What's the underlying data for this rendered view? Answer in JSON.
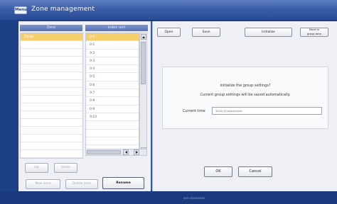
{
  "titlebar": {
    "menu_label": "Menu",
    "title": "Zone management"
  },
  "left": {
    "zone_header": "Zone",
    "index_header": "Index unit",
    "zones": [
      {
        "label": "Zone",
        "selected": true
      },
      {
        "label": "",
        "selected": false
      },
      {
        "label": "",
        "selected": false
      },
      {
        "label": "",
        "selected": false
      },
      {
        "label": "",
        "selected": false
      },
      {
        "label": "",
        "selected": false
      },
      {
        "label": "",
        "selected": false
      },
      {
        "label": "",
        "selected": false
      },
      {
        "label": "",
        "selected": false
      },
      {
        "label": "",
        "selected": false
      },
      {
        "label": "",
        "selected": false
      },
      {
        "label": "",
        "selected": false
      },
      {
        "label": "",
        "selected": false
      },
      {
        "label": "",
        "selected": false
      },
      {
        "label": "",
        "selected": false
      },
      {
        "label": "",
        "selected": false
      }
    ],
    "index_units": [
      {
        "label": "0:0",
        "selected": true
      },
      {
        "label": "0:1",
        "selected": false
      },
      {
        "label": "0:2",
        "selected": false
      },
      {
        "label": "0:3",
        "selected": false
      },
      {
        "label": "0:4",
        "selected": false
      },
      {
        "label": "0:5",
        "selected": false
      },
      {
        "label": "0:6",
        "selected": false
      },
      {
        "label": "0:7",
        "selected": false
      },
      {
        "label": "0:8",
        "selected": false
      },
      {
        "label": "0:9",
        "selected": false
      },
      {
        "label": "0:10",
        "selected": false
      },
      {
        "label": "",
        "selected": false
      },
      {
        "label": "",
        "selected": false
      },
      {
        "label": "",
        "selected": false
      },
      {
        "label": "",
        "selected": false
      }
    ],
    "buttons": {
      "up": "Up",
      "down": "Down",
      "new_zone": "New zone",
      "delete_zone": "Delete zone",
      "rename": "Rename"
    }
  },
  "right": {
    "buttons": {
      "open": "Open",
      "save": "Save",
      "initialize": "Initialize",
      "last_line1": "Move to",
      "last_line2": "group zone"
    },
    "dialog": {
      "message1": "Initialize the group settings?",
      "message2": "Current group settings will be saved automatically.",
      "current_time_label": "Current time",
      "current_time_value": "2011/11/xxxx/xx/xx",
      "ok": "OK",
      "cancel": "Cancel"
    }
  },
  "status": {
    "text": "xxx  xxxx/xx/xx"
  }
}
